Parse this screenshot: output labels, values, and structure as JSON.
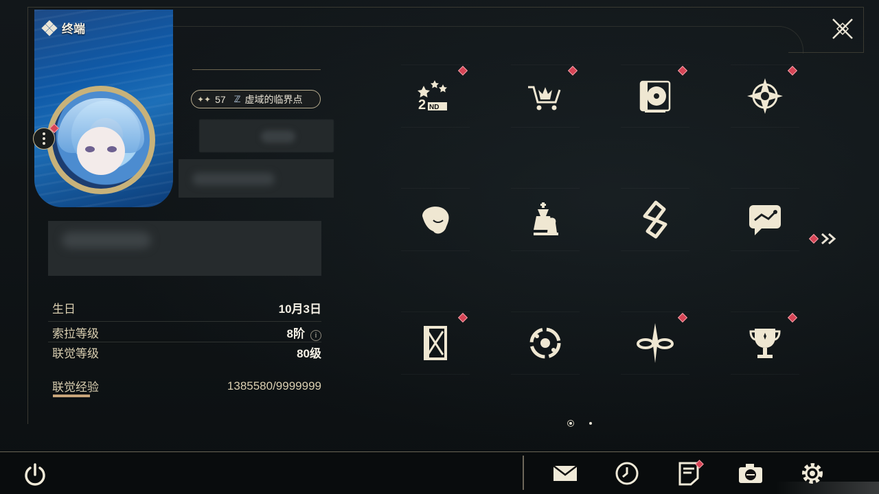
{
  "card": {
    "title": "终端"
  },
  "profile": {
    "level": "57",
    "world_title": "虚域的临界点"
  },
  "stats": {
    "birthday_label": "生日",
    "birthday_value": "10月3日",
    "sola_label": "索拉等级",
    "sola_value": "8阶",
    "info_icon": "i",
    "sync_label": "联觉等级",
    "sync_value": "80级",
    "exp_label": "联觉经验",
    "exp_value": "1385580/9999999"
  },
  "grid": {
    "tiles": [
      {
        "icon": "anniversary-2nd-icon",
        "badge": true
      },
      {
        "icon": "shop-cart-icon",
        "badge": true
      },
      {
        "icon": "record-player-icon",
        "badge": true
      },
      {
        "icon": "compass-star-icon",
        "badge": true
      },
      {
        "icon": "character-profile-icon",
        "badge": false
      },
      {
        "icon": "chess-pieces-icon",
        "badge": false
      },
      {
        "icon": "zigzag-emblem-icon",
        "badge": false
      },
      {
        "icon": "chat-screen-icon",
        "badge": false
      },
      {
        "icon": "card-frame-icon",
        "badge": true
      },
      {
        "icon": "orbit-circle-icon",
        "badge": false
      },
      {
        "icon": "knot-star-icon",
        "badge": true
      },
      {
        "icon": "trophy-icon",
        "badge": true
      }
    ],
    "page_current": 1,
    "page_count": 2
  },
  "bottom": {
    "icons": [
      "power-icon",
      "mail-icon",
      "clock-icon",
      "notes-icon",
      "camera-icon",
      "settings-icon"
    ]
  },
  "colors": {
    "accent": "#c8a57a",
    "badge": "#d64455",
    "background": "#0e1214",
    "text": "#e8e2d4"
  }
}
